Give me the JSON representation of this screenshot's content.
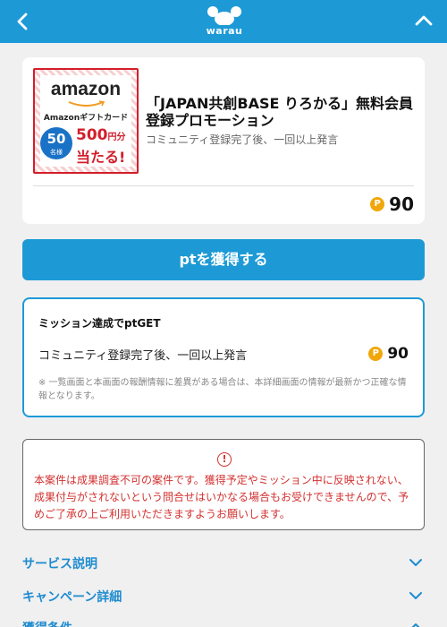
{
  "header": {
    "logo_text": "warau"
  },
  "offer": {
    "banner": {
      "brand": "amazon",
      "giftcard": "Amazonギフトカード",
      "count_num": "50",
      "count_unit": "名様",
      "amount": "500",
      "amount_unit": "円分",
      "win": "当たる!"
    },
    "title": "「JAPAN共創BASE りろかる」無料会員登録プロモーション",
    "subtitle": "コミュニティ登録完了後、一回以上発言",
    "points_icon": "P",
    "points": "90"
  },
  "cta_label": "ptを獲得する",
  "mission": {
    "heading": "ミッション達成でptGET",
    "condition": "コミュニティ登録完了後、一回以上発言",
    "points_icon": "P",
    "points": "90",
    "note": "※ 一覧画面と本画面の報酬情報に差異がある場合は、本詳細画面の情報が最新かつ正確な情報となります。"
  },
  "warning": {
    "icon_glyph": "!",
    "text": "本案件は成果調査不可の案件です。獲得予定やミッション中に反映されない、成果付与がされないという問合せはいかなる場合もお受けできませんので、予めご了承の上ご利用いただきますようお願いします。"
  },
  "accordions": [
    {
      "label": "サービス説明"
    },
    {
      "label": "キャンペーン詳細"
    },
    {
      "label": "獲得条件"
    }
  ],
  "colors": {
    "primary": "#1d9ad6",
    "warning": "#d2312f",
    "coin": "#f1a60a"
  }
}
